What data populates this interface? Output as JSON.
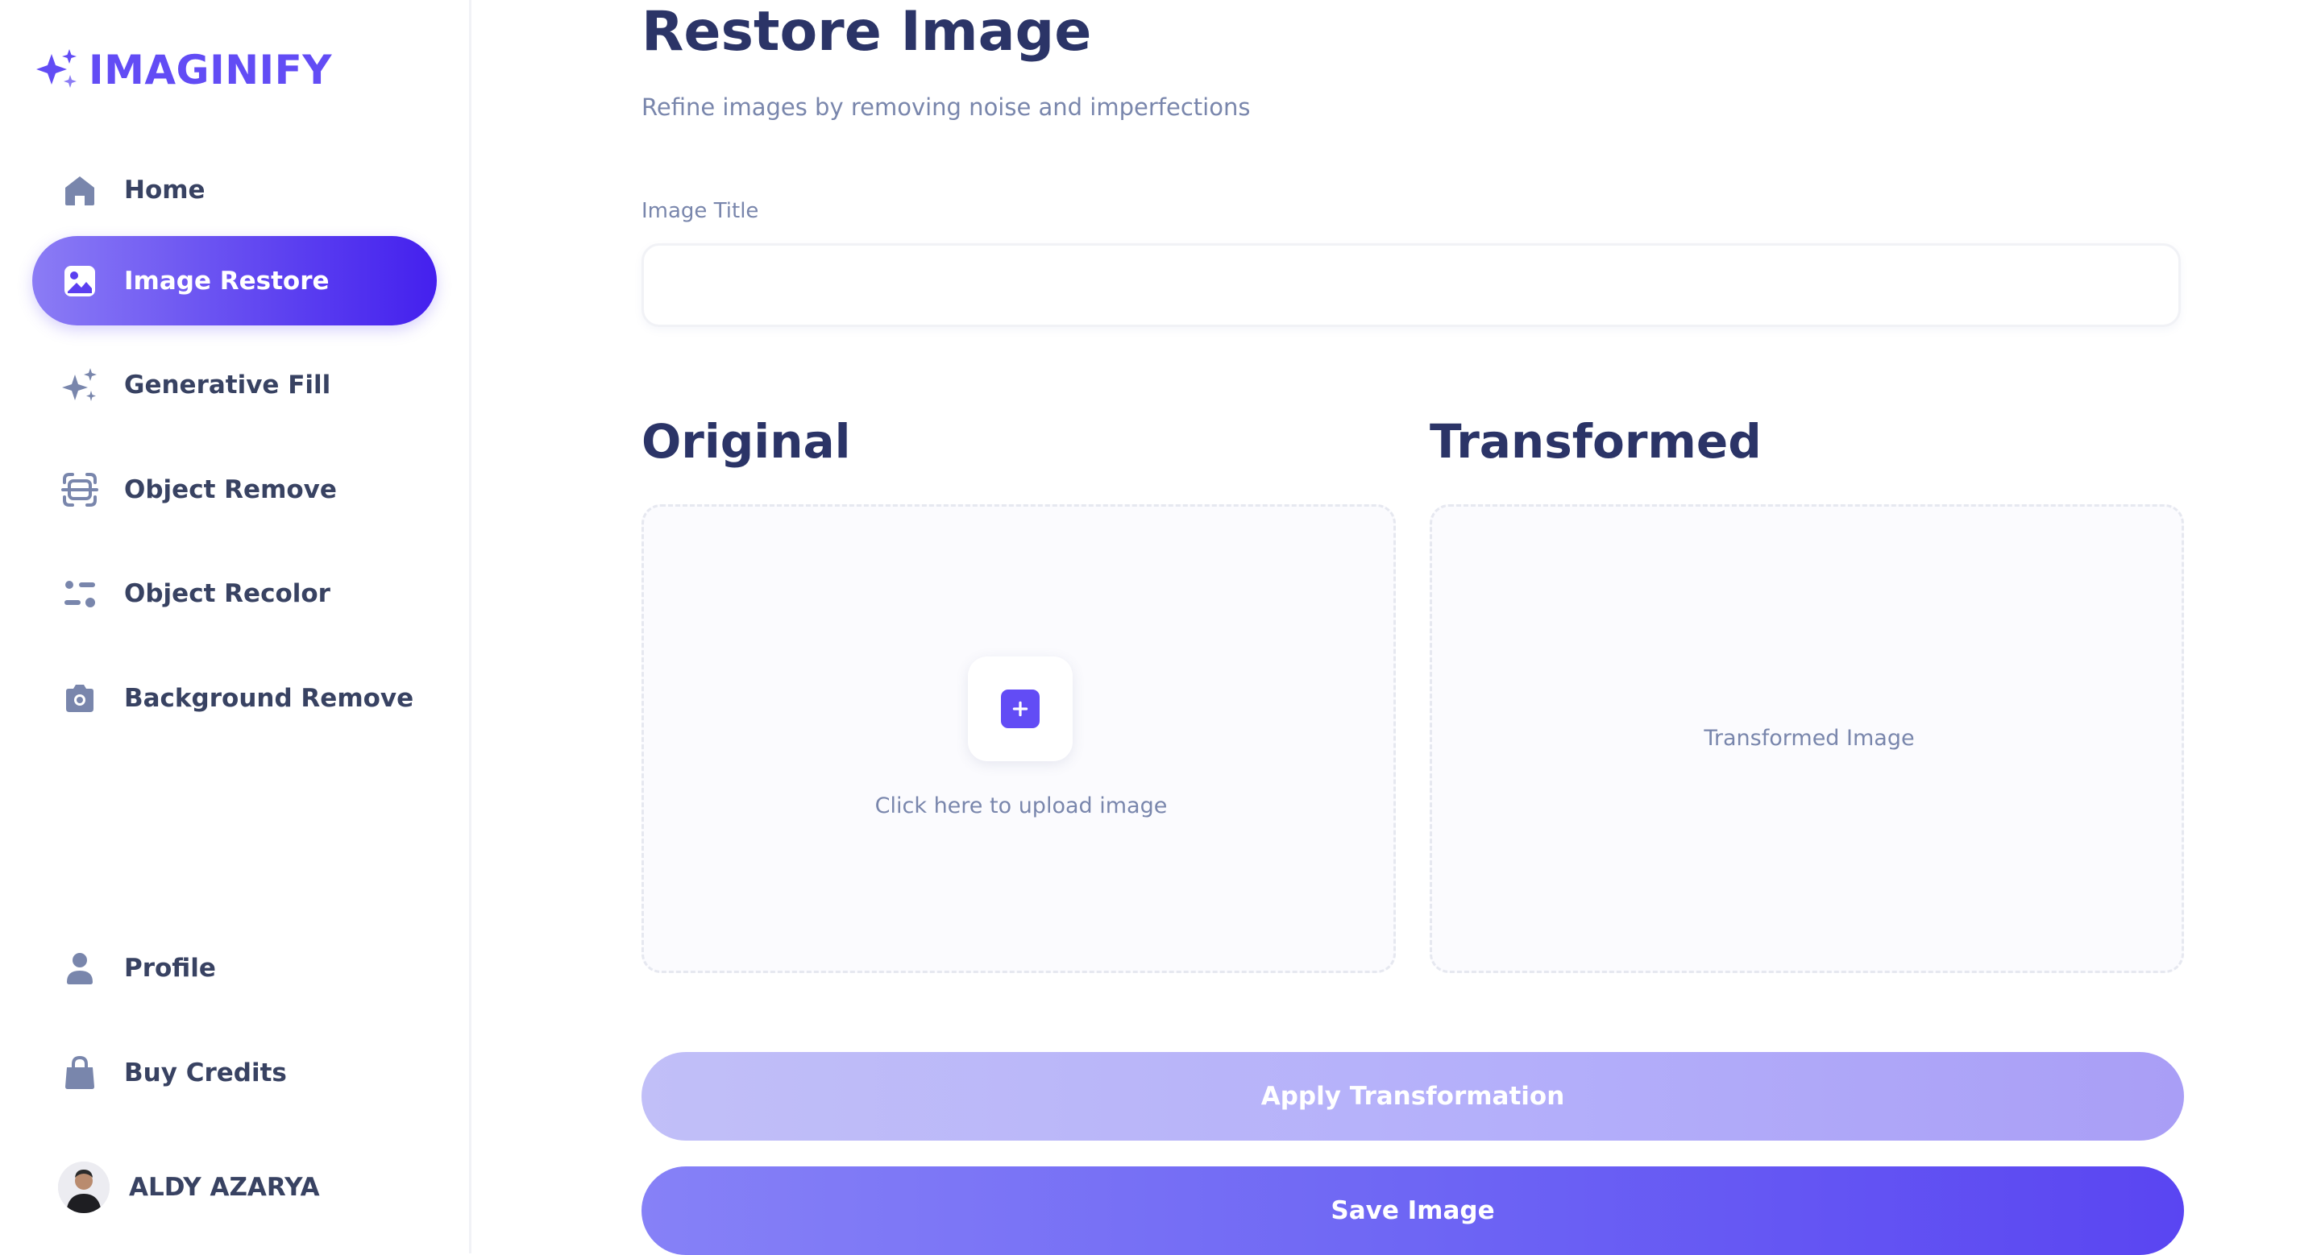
{
  "app": {
    "name": "IMAGINIFY",
    "brand_color": "#624cf5"
  },
  "sidebar": {
    "items": [
      {
        "label": "Home",
        "icon": "home-icon"
      },
      {
        "label": "Image Restore",
        "icon": "image-icon",
        "active": true
      },
      {
        "label": "Generative Fill",
        "icon": "stars-icon"
      },
      {
        "label": "Object Remove",
        "icon": "scan-icon"
      },
      {
        "label": "Object Recolor",
        "icon": "filter-icon"
      },
      {
        "label": "Background Remove",
        "icon": "camera-icon"
      }
    ],
    "bottom_items": [
      {
        "label": "Profile",
        "icon": "user-icon"
      },
      {
        "label": "Buy Credits",
        "icon": "bag-icon"
      }
    ],
    "user": {
      "name": "ALDY AZARYA"
    }
  },
  "main": {
    "title": "Restore Image",
    "subtitle": "Refine images by removing noise and imperfections",
    "image_title_label": "Image Title",
    "image_title_value": "",
    "original": {
      "heading": "Original",
      "upload_text": "Click here to upload image"
    },
    "transformed": {
      "heading": "Transformed",
      "placeholder": "Transformed Image"
    },
    "apply_label": "Apply Transformation",
    "save_label": "Save Image"
  }
}
